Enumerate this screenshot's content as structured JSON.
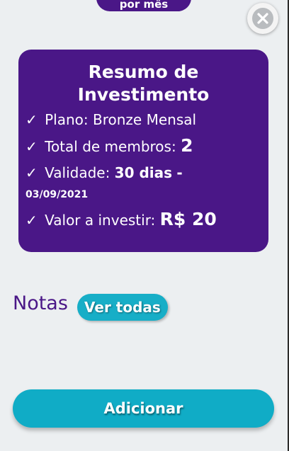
{
  "top_pill": {
    "label": "por mês"
  },
  "close": {
    "icon": "close-icon"
  },
  "summary": {
    "title": "Resumo de Investimento",
    "check": "✓",
    "plan_prefix": "Plano:",
    "plan_value": "Bronze Mensal",
    "members_prefix": "Total de membros:",
    "members_value": "2",
    "validity_prefix": "Validade:",
    "validity_value": "30 dias",
    "validity_sep": "-",
    "validity_date": "03/09/2021",
    "invest_prefix": "Valor a investir:",
    "invest_value": "R$ 20"
  },
  "notes": {
    "label": "Notas",
    "see_all": "Ver todas"
  },
  "add_button": {
    "label": "Adicionar"
  },
  "colors": {
    "purple": "#4a1787",
    "teal": "#10acc6",
    "background": "#eceff1"
  }
}
